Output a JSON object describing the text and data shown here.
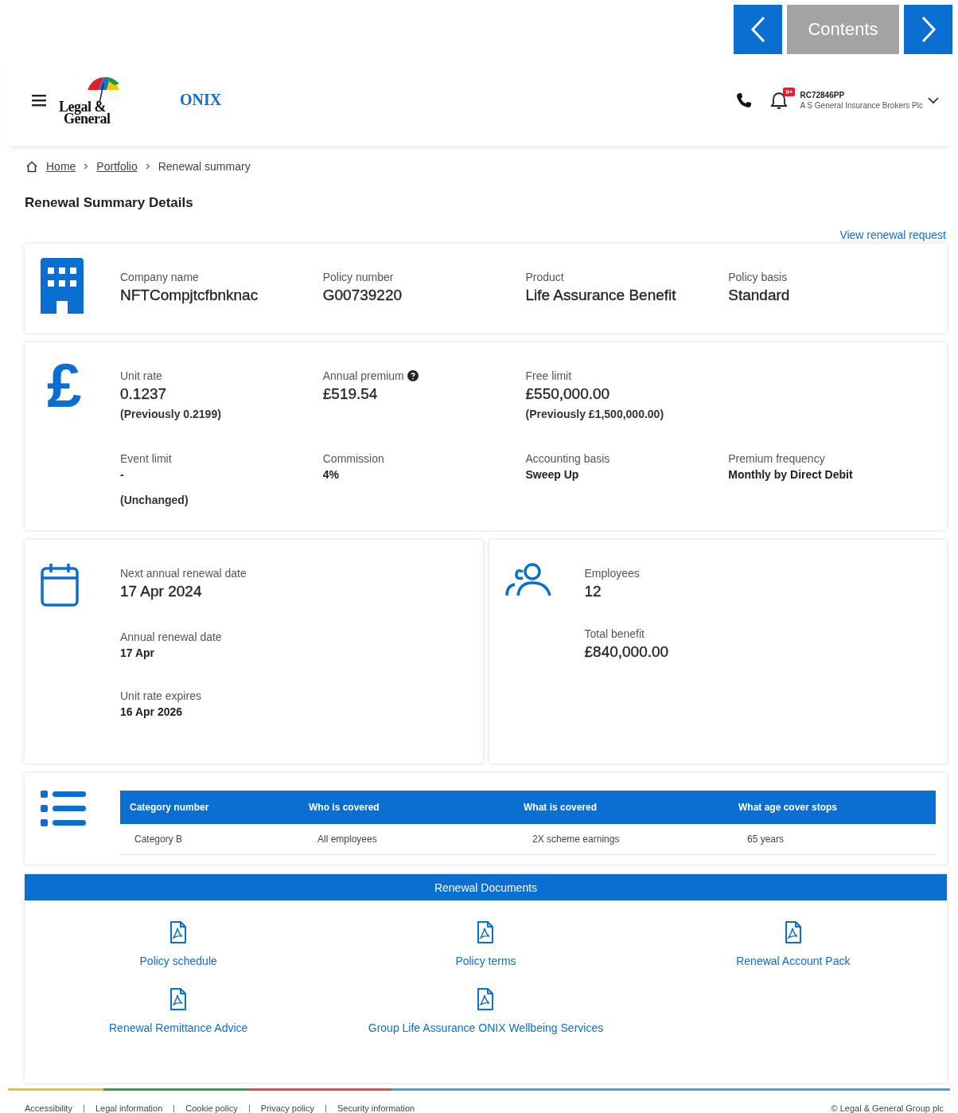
{
  "nav": {
    "contents_button": "Contents"
  },
  "header": {
    "logo_lines": [
      "Legal &",
      "General"
    ],
    "app_name": "ONIX",
    "notification_badge": "9+",
    "account_id": "RC72846PP",
    "account_name": "A S General Insurance Brokers Plc"
  },
  "breadcrumb": [
    {
      "label": "Home",
      "link": true
    },
    {
      "label": "Portfolio",
      "link": true
    },
    {
      "label": "Renewal summary",
      "link": false
    }
  ],
  "page_title": "Renewal Summary Details",
  "view_link": "View renewal request",
  "policy_card": {
    "fields": [
      {
        "label": "Company name",
        "value": "NFTCompjtcfbnknac"
      },
      {
        "label": "Policy number",
        "value": "G00739220"
      },
      {
        "label": "Product",
        "value": "Life Assurance Benefit"
      },
      {
        "label": "Policy basis",
        "value": "Standard"
      }
    ]
  },
  "rates_card": {
    "icon": "£",
    "rows": [
      [
        {
          "kind": "primary",
          "label": "Unit rate",
          "value": "0.1237",
          "note": "(Previously 0.2199)",
          "help": false
        },
        {
          "kind": "primary",
          "label": "Annual premium",
          "value": "£519.54",
          "help": true
        },
        {
          "kind": "primary",
          "label": "Free limit",
          "value": "£550,000.00",
          "note": "(Previously £1,500,000.00)",
          "help": false
        }
      ],
      [
        {
          "kind": "secondary",
          "label": "Event limit",
          "value": "-",
          "note": "(Unchanged)",
          "help": false
        },
        {
          "kind": "secondary",
          "label": "Commission",
          "value": "4%",
          "help": false
        },
        {
          "kind": "secondary",
          "label": "Accounting basis",
          "value": "Sweep Up",
          "help": false
        },
        {
          "kind": "secondary",
          "label": "Premium frequency",
          "value": "Monthly by Direct Debit",
          "help": false
        }
      ]
    ]
  },
  "dates_card": {
    "fields": [
      {
        "kind": "primary",
        "label": "Next annual renewal date",
        "value": "17 Apr 2024"
      },
      {
        "kind": "secondary",
        "label": "Annual renewal date",
        "value": "17 Apr"
      },
      {
        "kind": "secondary",
        "label": "Unit rate expires",
        "value": "16 Apr 2026"
      }
    ]
  },
  "people_card": {
    "fields": [
      {
        "label": "Employees",
        "value": "12"
      },
      {
        "label": "Total benefit",
        "value": "£840,000.00"
      }
    ]
  },
  "categories": {
    "columns": [
      "Category number",
      "Who is covered",
      "What is covered",
      "What age cover stops"
    ],
    "rows": [
      [
        "Category B",
        "All employees",
        "2X scheme earnings",
        "65 years"
      ]
    ]
  },
  "documents": {
    "title": "Renewal Documents",
    "items": [
      "Policy schedule",
      "Policy terms",
      "Renewal Account Pack",
      "Renewal Remittance Advice",
      "Group Life Assurance ONIX Wellbeing Services"
    ]
  },
  "footer": {
    "links": [
      "Accessibility",
      "Legal information",
      "Cookie policy",
      "Privacy policy",
      "Security information"
    ],
    "copyright": "© Legal & General Group plc"
  }
}
